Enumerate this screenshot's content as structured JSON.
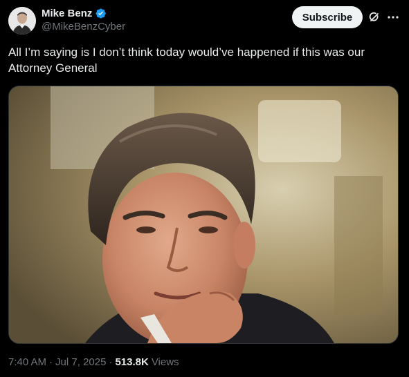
{
  "author": {
    "display_name": "Mike Benz",
    "handle": "@MikeBenzCyber",
    "verified_color": "#1d9bf0"
  },
  "actions": {
    "subscribe_label": "Subscribe",
    "grok_icon": "grok-icon",
    "more_icon": "more-icon"
  },
  "tweet": {
    "text": "All I’m saying is I don’t think today would’ve happened if this was our Attorney General"
  },
  "media": {
    "kind": "photo",
    "subject": "photo-of-man"
  },
  "meta": {
    "time": "7:40 AM",
    "date": "Jul 7, 2025",
    "separator": "·",
    "views_count": "513.8K",
    "views_label": "Views"
  },
  "colors": {
    "background": "#000000",
    "text_primary": "#e7e9ea",
    "text_secondary": "#71767b",
    "button_bg": "#eff3f4",
    "accent": "#1d9bf0"
  }
}
